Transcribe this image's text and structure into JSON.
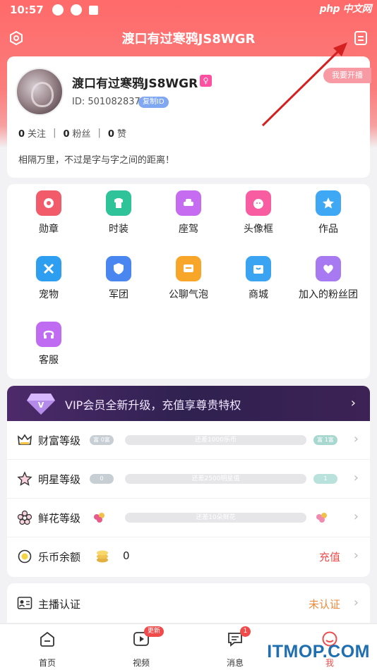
{
  "status_bar": {
    "time": "10:57"
  },
  "watermark_top": "php 中文网",
  "header": {
    "title": "渡口有过寒鸦JS8WGR"
  },
  "profile": {
    "name": "渡口有过寒鸦JS8WGR",
    "id_text": "ID: 501082837",
    "copy_id_label": "复制ID",
    "live_tag": "我要开播",
    "following_count": "0",
    "following_label": "关注",
    "fans_count": "0",
    "fans_label": "粉丝",
    "likes_count": "0",
    "likes_label": "赞",
    "bio": "相隔万里，不过是字与字之间的距离！"
  },
  "features": [
    {
      "label": "勋章",
      "icon": "medal-icon",
      "color": "#f25b6a"
    },
    {
      "label": "时装",
      "icon": "shirt-icon",
      "color": "#2fc39a"
    },
    {
      "label": "座驾",
      "icon": "car-icon",
      "color": "#c56cf0"
    },
    {
      "label": "头像框",
      "icon": "avatar-frame-icon",
      "color": "#f75da0"
    },
    {
      "label": "作品",
      "icon": "star-icon",
      "color": "#3ea8f5"
    },
    {
      "label": "宠物",
      "icon": "pet-icon",
      "color": "#2e9ef0"
    },
    {
      "label": "军团",
      "icon": "shield-icon",
      "color": "#4a86f0"
    },
    {
      "label": "公聊气泡",
      "icon": "bubble-icon",
      "color": "#f8a62a"
    },
    {
      "label": "商城",
      "icon": "shop-icon",
      "color": "#3aa3f2"
    },
    {
      "label": "加入的粉丝团",
      "icon": "fan-club-icon",
      "color": "#a77af2"
    },
    {
      "label": "客服",
      "icon": "headset-icon",
      "color": "#c06cf2"
    }
  ],
  "vip": {
    "text": "VIP会员全新升级，充值享尊贵特权"
  },
  "levels": {
    "wealth": {
      "title": "财富等级",
      "left_badge": "富 0富",
      "bar_text": "还差1000乐币",
      "right_badge": "富 1富"
    },
    "star": {
      "title": "明星等级",
      "left_badge": "0",
      "bar_text": "还差2500明星值",
      "right_badge": "1"
    },
    "flower": {
      "title": "鲜花等级",
      "left_badge": "",
      "bar_text": "还差10朵鲜花",
      "right_badge": ""
    },
    "balance": {
      "title": "乐币余额",
      "value": "0",
      "action": "充值"
    }
  },
  "auth": {
    "title": "主播认证",
    "status": "未认证"
  },
  "tabs": [
    {
      "label": "首页",
      "badge": ""
    },
    {
      "label": "视频",
      "badge": "更新"
    },
    {
      "label": "消息",
      "badge": "1"
    },
    {
      "label": "我",
      "badge": ""
    }
  ],
  "watermark_bottom": "ITMOP.COM"
}
